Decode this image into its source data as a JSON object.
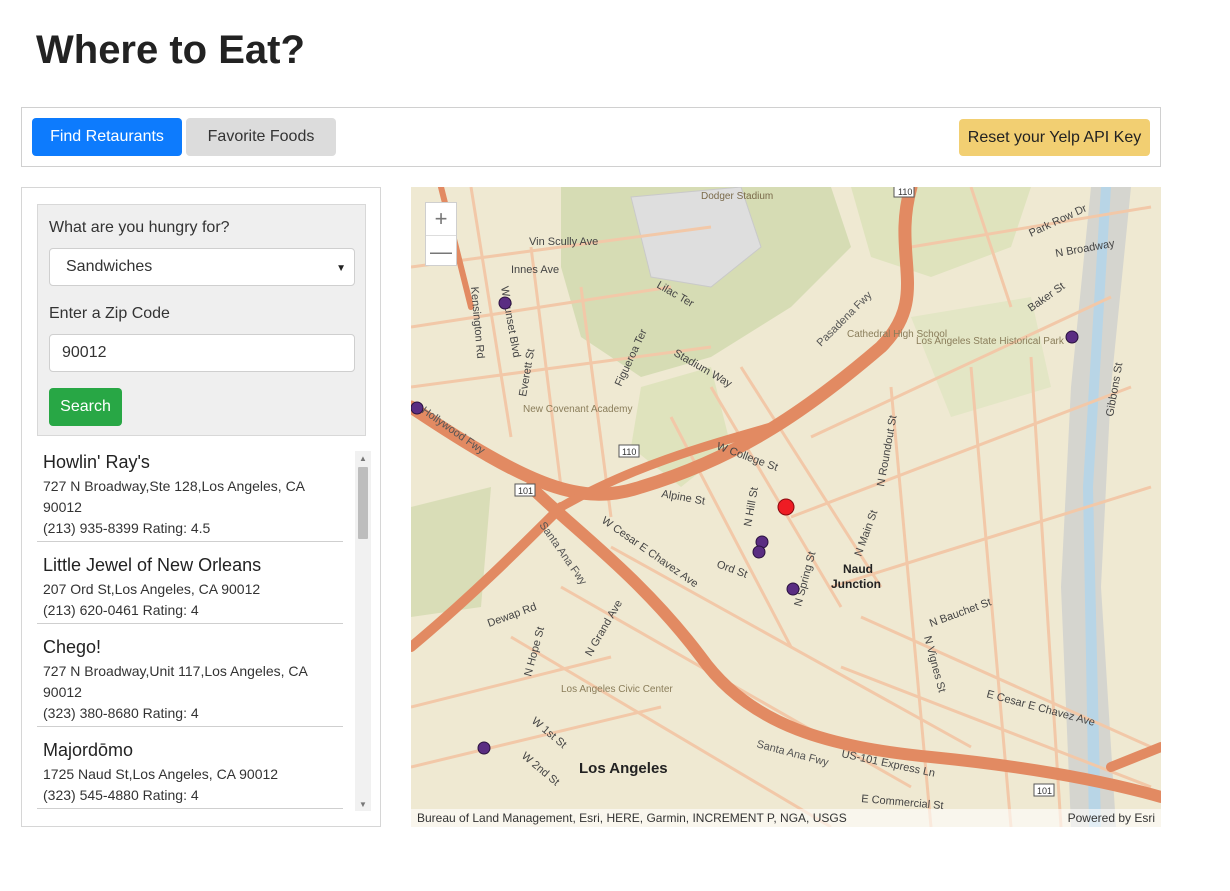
{
  "page": {
    "title": "Where to Eat?"
  },
  "toolbar": {
    "find_label": "Find Retaurants",
    "favorites_label": "Favorite Foods",
    "reset_label": "Reset your Yelp API Key"
  },
  "search": {
    "food_label": "What are you hungry for?",
    "food_selected": "Sandwiches",
    "zip_label": "Enter a Zip Code",
    "zip_value": "90012",
    "search_label": "Search"
  },
  "results": [
    {
      "name": "Howlin' Ray's",
      "address": "727 N Broadway,Ste 128,Los Angeles, CA 90012",
      "phone_rating": "(213) 935-8399 Rating: 4.5"
    },
    {
      "name": "Little Jewel of New Orleans",
      "address": "207 Ord St,Los Angeles, CA 90012",
      "phone_rating": "(213) 620-0461 Rating: 4"
    },
    {
      "name": "Chego!",
      "address": "727 N Broadway,Unit 117,Los Angeles, CA 90012",
      "phone_rating": "(323) 380-8680 Rating: 4"
    },
    {
      "name": "Majordōmo",
      "address": "1725 Naud St,Los Angeles, CA 90012",
      "phone_rating": "(323) 545-4880 Rating: 4"
    }
  ],
  "map": {
    "zoom_in": "+",
    "zoom_out": "—",
    "attribution": "Bureau of Land Management, Esri, HERE, Garmin, INCREMENT P, NGA, USGS",
    "powered_by": "Powered by Esri",
    "labels": {
      "los_angeles": "Los Angeles",
      "naud_junction_1": "Naud",
      "naud_junction_2": "Junction",
      "vin_scully": "Vin Scully Ave",
      "n_broadway": "N Broadway",
      "pasadena_fwy": "Pasadena Fwy",
      "hollywood_fwy": "Hollywood Fwy",
      "santa_ana_fwy": "Santa Ana Fwy",
      "us101": "US-101 Express Ln",
      "cesar_chavez": "W Cesar E Chavez Ave",
      "cesar_chavez_e": "E Cesar E Chavez Ave",
      "alpine": "Alpine St",
      "college": "W College St",
      "ord": "Ord St",
      "n_hill": "N Hill St",
      "stadium": "Stadium Way",
      "lilac": "Lilac Ter",
      "park_row": "Park Row Dr",
      "cathedral": "Cathedral High School",
      "state_park": "Los Angeles State Historical Park",
      "new_covenant": "New Covenant Academy",
      "civic_center": "Los Angeles Civic Center",
      "commercial": "E Commercial St",
      "main": "N Main St",
      "spring": "N Spring St",
      "hope": "N Hope St",
      "grand": "N Grand Ave",
      "first": "W 1st St",
      "second": "W 2nd St",
      "sunset": "W Sunset Blvd",
      "dewap": "Dewap Rd",
      "innes": "Innes Ave",
      "baker": "Baker St",
      "gibbons": "Gibbons St",
      "roundout": "N Roundout St",
      "bauchet": "N Bauchet St",
      "vignes": "N Vignes St",
      "figueroa": "Figueroa Ter",
      "kensington": "Kensington Rd",
      "everett": "Everett St",
      "dodger": "Dodger Stadium"
    }
  },
  "markers": {
    "highlight_color": "#ee1c24",
    "marker_color": "#5a2d82"
  }
}
